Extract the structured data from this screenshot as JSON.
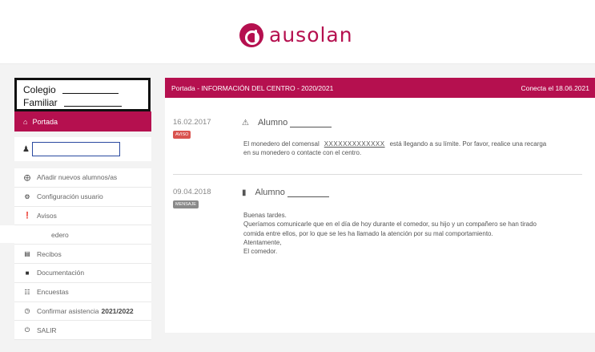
{
  "brand": {
    "name": "ausolan",
    "color": "#b5104f"
  },
  "school": {
    "line1": "Colegio",
    "line2": "Familiar"
  },
  "sidebar": {
    "portada": {
      "icon": "home-icon",
      "label": "Portada"
    },
    "user_input": {
      "value": "",
      "icon": "user-icon"
    },
    "items": [
      {
        "icon": "plus-circle-icon",
        "label": "Añadir nuevos alumnos/as"
      },
      {
        "icon": "gear-icon",
        "label": "Configuración usuario"
      },
      {
        "icon": "alert-circle-icon",
        "label": "Avisos"
      },
      {
        "icon": "",
        "label": "edero"
      },
      {
        "icon": "receipt-icon",
        "label": "Recibos"
      },
      {
        "icon": "document-icon",
        "label": "Documentación"
      },
      {
        "icon": "survey-icon",
        "label": "Encuestas"
      },
      {
        "icon": "clock-check-icon",
        "label": "Confirmar asistencia",
        "bold": "2021/2022"
      },
      {
        "icon": "power-icon",
        "label": "SALIR"
      }
    ]
  },
  "panel": {
    "title": "Portada - INFORMACIÓN DEL CENTRO - 2020/2021",
    "connected": "Conecta el 18.06.2021"
  },
  "entries": [
    {
      "date": "16.02.2017",
      "badge": "AVISO",
      "badge_color": "#d9534f",
      "icon": "warning-icon",
      "student": "Alumno",
      "body_pre": "El monedero del comensal",
      "body_code": "XXXXXXXXXXXXX",
      "body_post": "está llegando a su límite. Por favor, realice una recarga",
      "body_line2": "en su monedero o contacte con el centro."
    },
    {
      "date": "09.04.2018",
      "badge": "MENSAJE",
      "badge_color": "#8a8a8a",
      "icon": "message-icon",
      "student": "Alumno",
      "lines": [
        "Buenas tardes.",
        "Queríamos comunicarle que en el día de hoy durante el comedor, su hijo y un compañero se han tirado",
        "comida entre ellos, por lo que se les ha llamado la atención por su mal comportamiento.",
        "Atentamente,",
        "El comedor."
      ]
    }
  ]
}
